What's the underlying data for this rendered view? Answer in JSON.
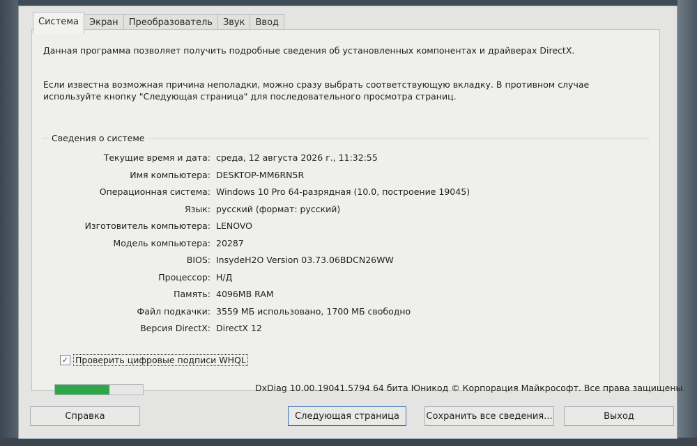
{
  "tabs": [
    {
      "label": "Система"
    },
    {
      "label": "Экран"
    },
    {
      "label": "Преобразователь"
    },
    {
      "label": "Звук"
    },
    {
      "label": "Ввод"
    }
  ],
  "intro": {
    "line1": "Данная программа позволяет получить подробные сведения об установленных компонентах и драйверах DirectX.",
    "line2": "Если известна возможная причина неполадки, можно сразу выбрать соответствующую вкладку. В противном случае используйте кнопку \"Следующая страница\" для последовательного просмотра страниц."
  },
  "system_info": {
    "title": "Сведения о системе",
    "rows": [
      {
        "label": "Текущие время и дата:",
        "value": "среда, 12 августа 2026 г., 11:32:55"
      },
      {
        "label": "Имя компьютера:",
        "value": "DESKTOP-MM6RN5R"
      },
      {
        "label": "Операционная система:",
        "value": "Windows 10 Pro 64-разрядная (10.0, построение 19045)"
      },
      {
        "label": "Язык:",
        "value": "русский (формат: русский)"
      },
      {
        "label": "Изготовитель компьютера:",
        "value": "LENOVO"
      },
      {
        "label": "Модель компьютера:",
        "value": "20287"
      },
      {
        "label": "BIOS:",
        "value": "InsydeH2O Version 03.73.06BDCN26WW"
      },
      {
        "label": "Процессор:",
        "value": "Н/Д"
      },
      {
        "label": "Память:",
        "value": "4096MB RAM"
      },
      {
        "label": "Файл подкачки:",
        "value": "3559 МБ использовано, 1700 МБ свободно"
      },
      {
        "label": "Версия DirectX:",
        "value": "DirectX 12"
      }
    ]
  },
  "whql": {
    "label": "Проверить цифровые подписи WHQL",
    "checked": true,
    "check_glyph": "✓"
  },
  "progress": {
    "fraction": 0.62,
    "color": "#2fa64a"
  },
  "copyright": "DxDiag 10.00.19041.5794 64 бита Юникод © Корпорация Майкрософт. Все права защищены.",
  "buttons": {
    "help": "Справка",
    "next": "Следующая страница",
    "save": "Сохранить все сведения...",
    "exit": "Выход"
  }
}
